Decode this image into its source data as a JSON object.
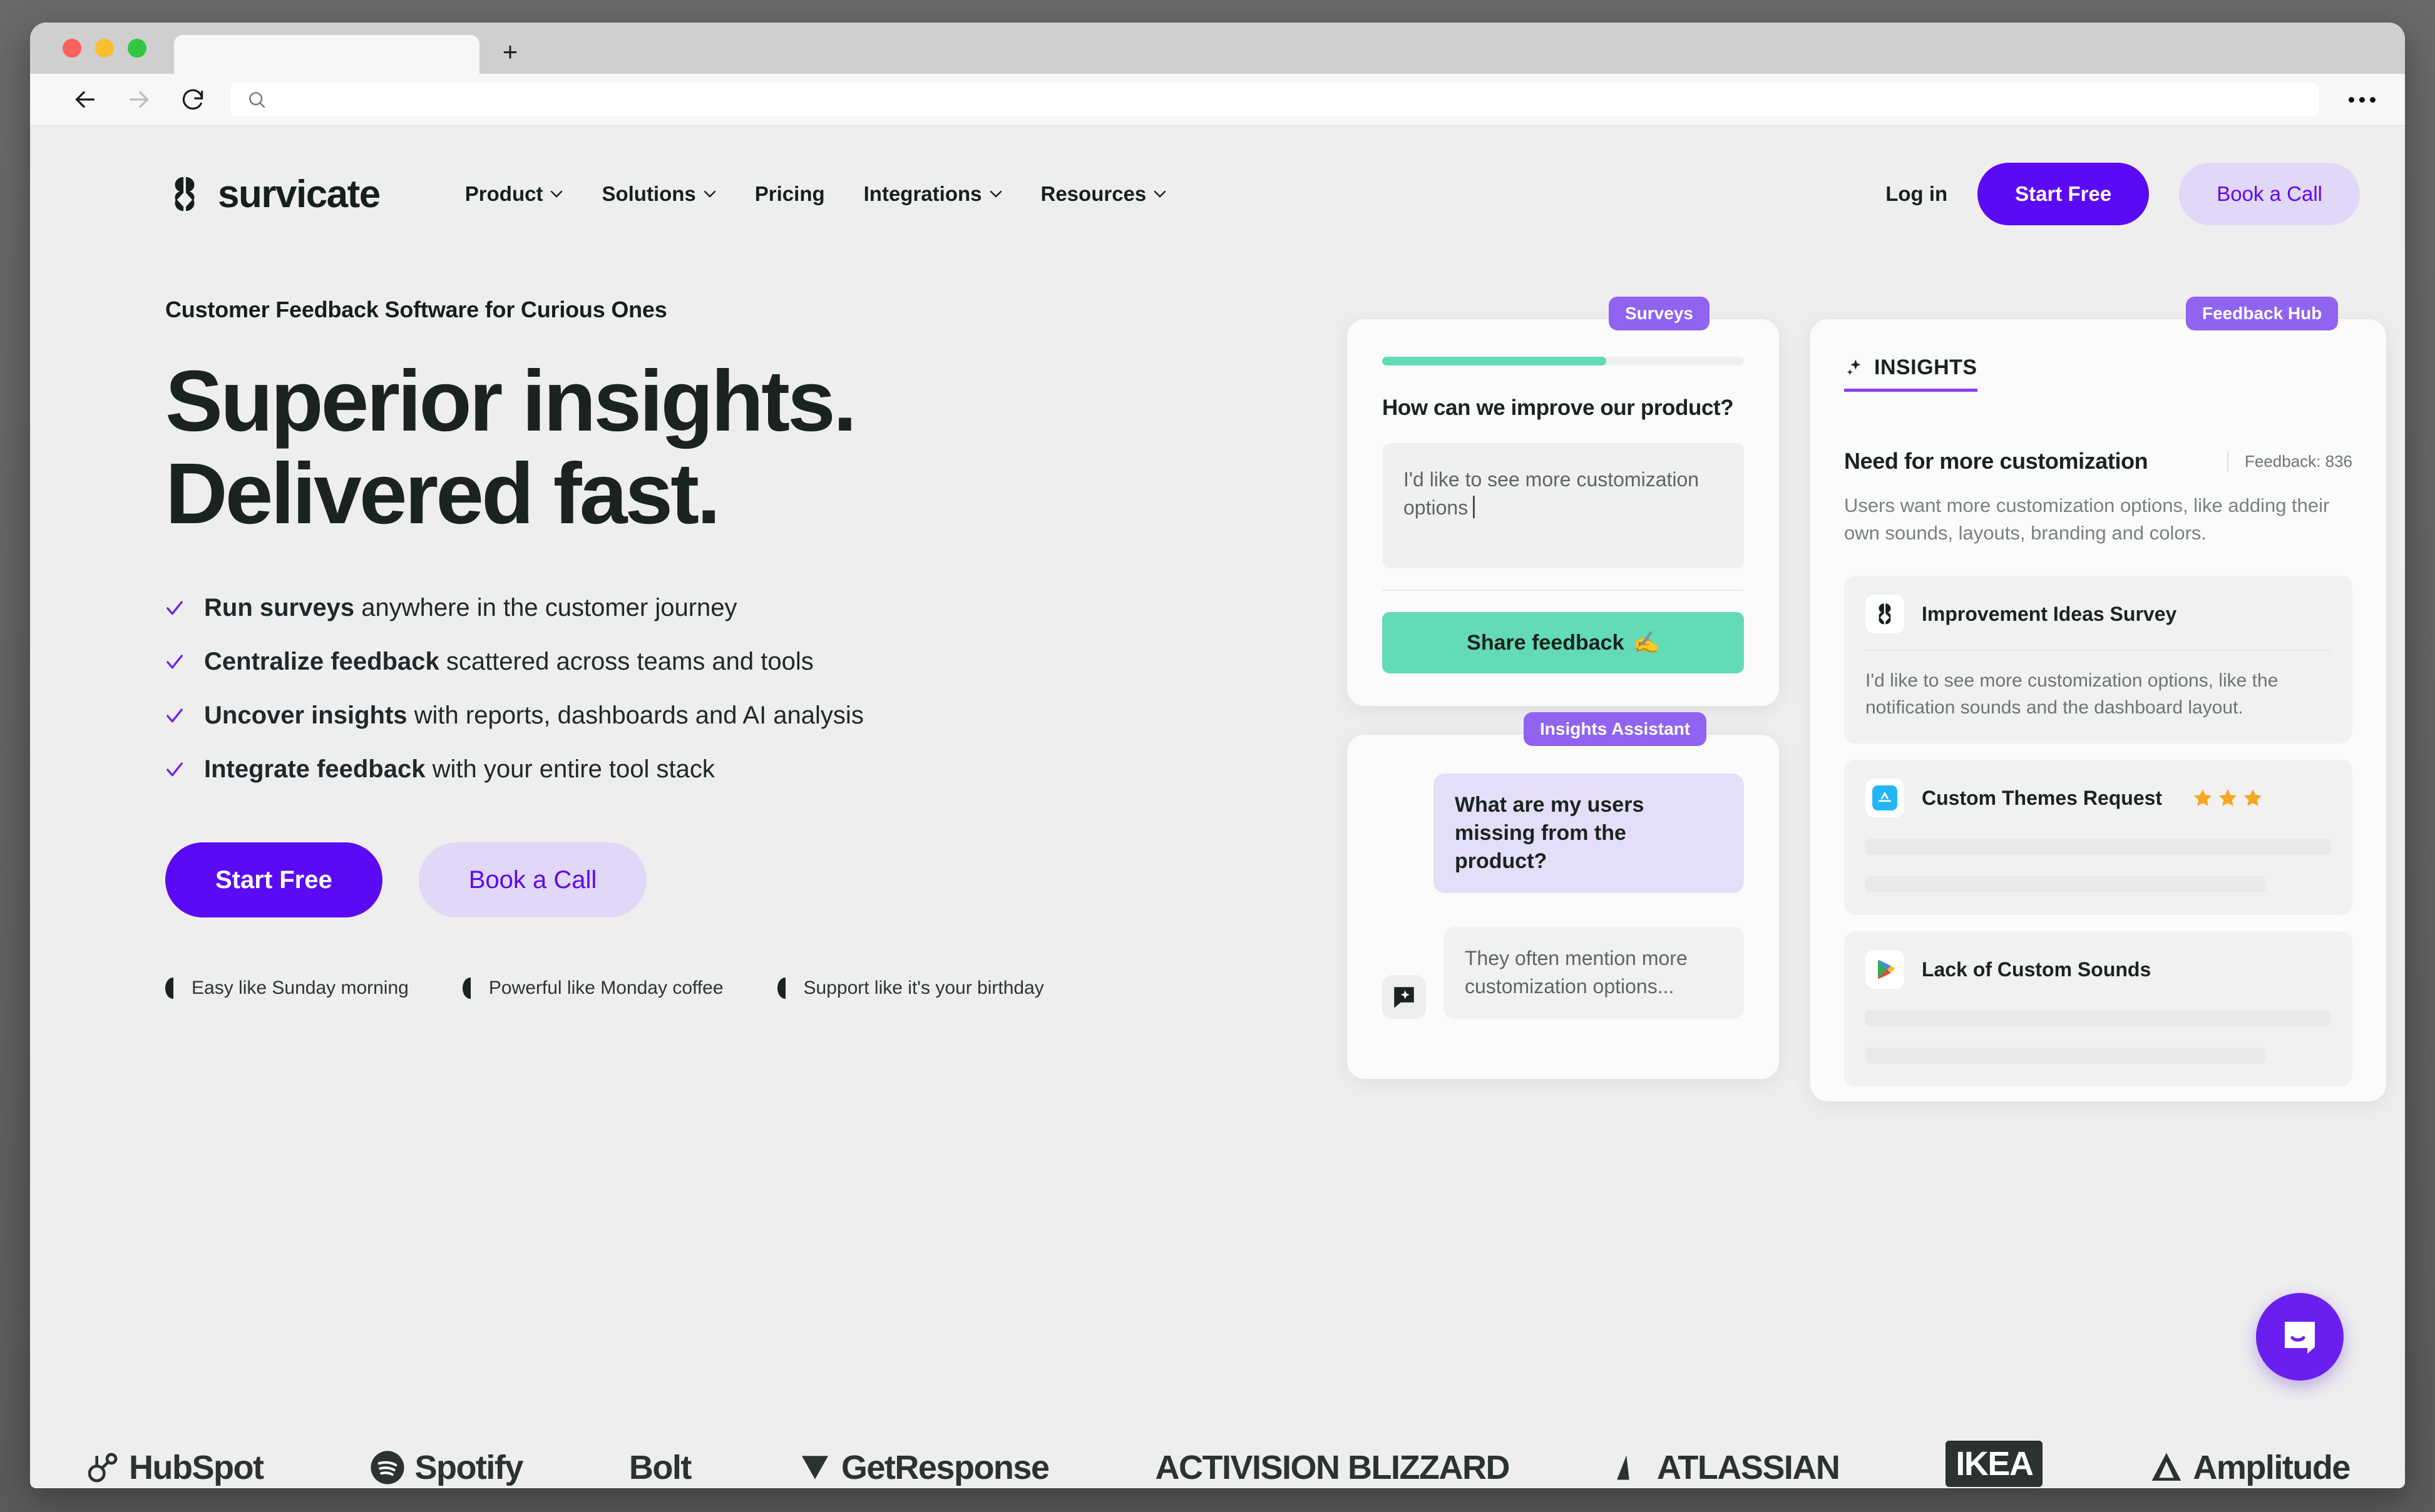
{
  "browser": {
    "tab_title": "",
    "url_value": "",
    "url_placeholder": "",
    "back_icon": "back-arrow-icon",
    "forward_icon": "forward-arrow-icon",
    "reload_icon": "reload-icon",
    "search_icon": "search-icon",
    "new_tab_label": "+",
    "menu_icon": "overflow-menu-icon"
  },
  "site_header": {
    "brand_name": "survicate",
    "nav": [
      {
        "label": "Product",
        "has_chevron": true
      },
      {
        "label": "Solutions",
        "has_chevron": true
      },
      {
        "label": "Pricing",
        "has_chevron": false
      },
      {
        "label": "Integrations",
        "has_chevron": true
      },
      {
        "label": "Resources",
        "has_chevron": true
      }
    ],
    "login_label": "Log in",
    "start_free_label": "Start Free",
    "book_call_label": "Book a Call"
  },
  "hero": {
    "eyebrow": "Customer Feedback Software for Curious Ones",
    "headline_line1": "Superior insights.",
    "headline_line2": "Delivered fast.",
    "bullets": [
      {
        "bold": "Run surveys",
        "rest": " anywhere in the customer journey"
      },
      {
        "bold": "Centralize feedback",
        "rest": " scattered across teams and tools"
      },
      {
        "bold": "Uncover insights",
        "rest": " with reports, dashboards and AI analysis"
      },
      {
        "bold": "Integrate feedback",
        "rest": " with your entire tool stack"
      }
    ],
    "cta_primary": "Start Free",
    "cta_secondary": "Book a Call",
    "trust_items": [
      "Easy like Sunday morning",
      "Powerful like Monday coffee",
      "Support like it's your birthday"
    ]
  },
  "art": {
    "survey_card": {
      "ribbon": "Surveys",
      "progress_percent": 62,
      "question": "How can we improve our product?",
      "answer_value": "I'd like to see more customization options",
      "submit_label": "Share feedback",
      "submit_emoji": "✍️"
    },
    "assistant_card": {
      "ribbon": "Insights Assistant",
      "user_message": "What are my users missing from the product?",
      "bot_message": "They often mention more customization options...",
      "avatar_icon": "ai-chat-sparkle-icon"
    },
    "hub_card": {
      "ribbon": "Feedback Hub",
      "tab_label": "INSIGHTS",
      "tab_icon": "sparkle-icon",
      "insight_title": "Need for more customization",
      "insight_count": "Feedback: 836",
      "insight_description": "Users want more customization options, like adding their own sounds, layouts, branding and colors.",
      "items": [
        {
          "icon": "survicate-logo-icon",
          "name": "Improvement Ideas Survey",
          "stars": 0,
          "body": "I'd like to see more customization options, like the notification sounds and the dashboard layout.",
          "ghost_lines": 0
        },
        {
          "icon": "app-store-icon",
          "name": "Custom Themes Request",
          "stars": 3,
          "body": "",
          "ghost_lines": 2
        },
        {
          "icon": "google-play-icon",
          "name": "Lack of Custom Sounds",
          "stars": 0,
          "body": "",
          "ghost_lines": 2
        }
      ]
    }
  },
  "logos": [
    {
      "name": "HubSpot",
      "icon": "hubspot-logo"
    },
    {
      "name": "Spotify",
      "icon": "spotify-logo"
    },
    {
      "name": "Bolt",
      "icon": "bolt-logo"
    },
    {
      "name": "GetResponse",
      "icon": "getresponse-logo"
    },
    {
      "name": "ACTIVISION BLIZZARD",
      "icon": "activision-blizzard-logo"
    },
    {
      "name": "ATLASSIAN",
      "icon": "atlassian-logo"
    },
    {
      "name": "IKEA",
      "icon": "ikea-logo"
    },
    {
      "name": "Amplitude",
      "icon": "amplitude-logo"
    }
  ],
  "chat_widget": {
    "icon": "intercom-chat-icon"
  },
  "colors": {
    "accent_purple": "#5b0af5",
    "accent_purple_light": "#e1d7f7",
    "ribbon_purple": "#9063f0",
    "mint_green": "#63dbb6",
    "page_bg": "#efeeee",
    "text_dark": "#1b2320",
    "text_muted": "#7a817f",
    "star_gold": "#f5a623"
  }
}
